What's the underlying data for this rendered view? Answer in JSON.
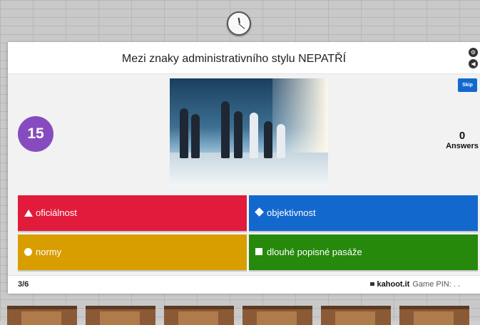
{
  "question": {
    "text": "Mezi znaky administrativního stylu NEPATŘÍ",
    "timer": "15",
    "answers_count": "0",
    "answers_label": "Answers",
    "skip_label": "Skip",
    "image_description_icon": "photo-business-people-walking"
  },
  "choices": [
    {
      "label": "oficiálnost",
      "shape": "triangle",
      "color": "#e21b3c"
    },
    {
      "label": "objektivnost",
      "shape": "diamond",
      "color": "#1368ce"
    },
    {
      "label": "normy",
      "shape": "circle",
      "color": "#d89e00"
    },
    {
      "label": "dlouhé popisné pasáže",
      "shape": "square",
      "color": "#26890c"
    }
  ],
  "footer": {
    "progress": "3/6",
    "site": "kahoot.it",
    "pin_label": "Game PIN:",
    "pin_value": ". ."
  },
  "controls": {
    "top_icon": "settings-icon",
    "bottom_icon": "sound-icon"
  }
}
